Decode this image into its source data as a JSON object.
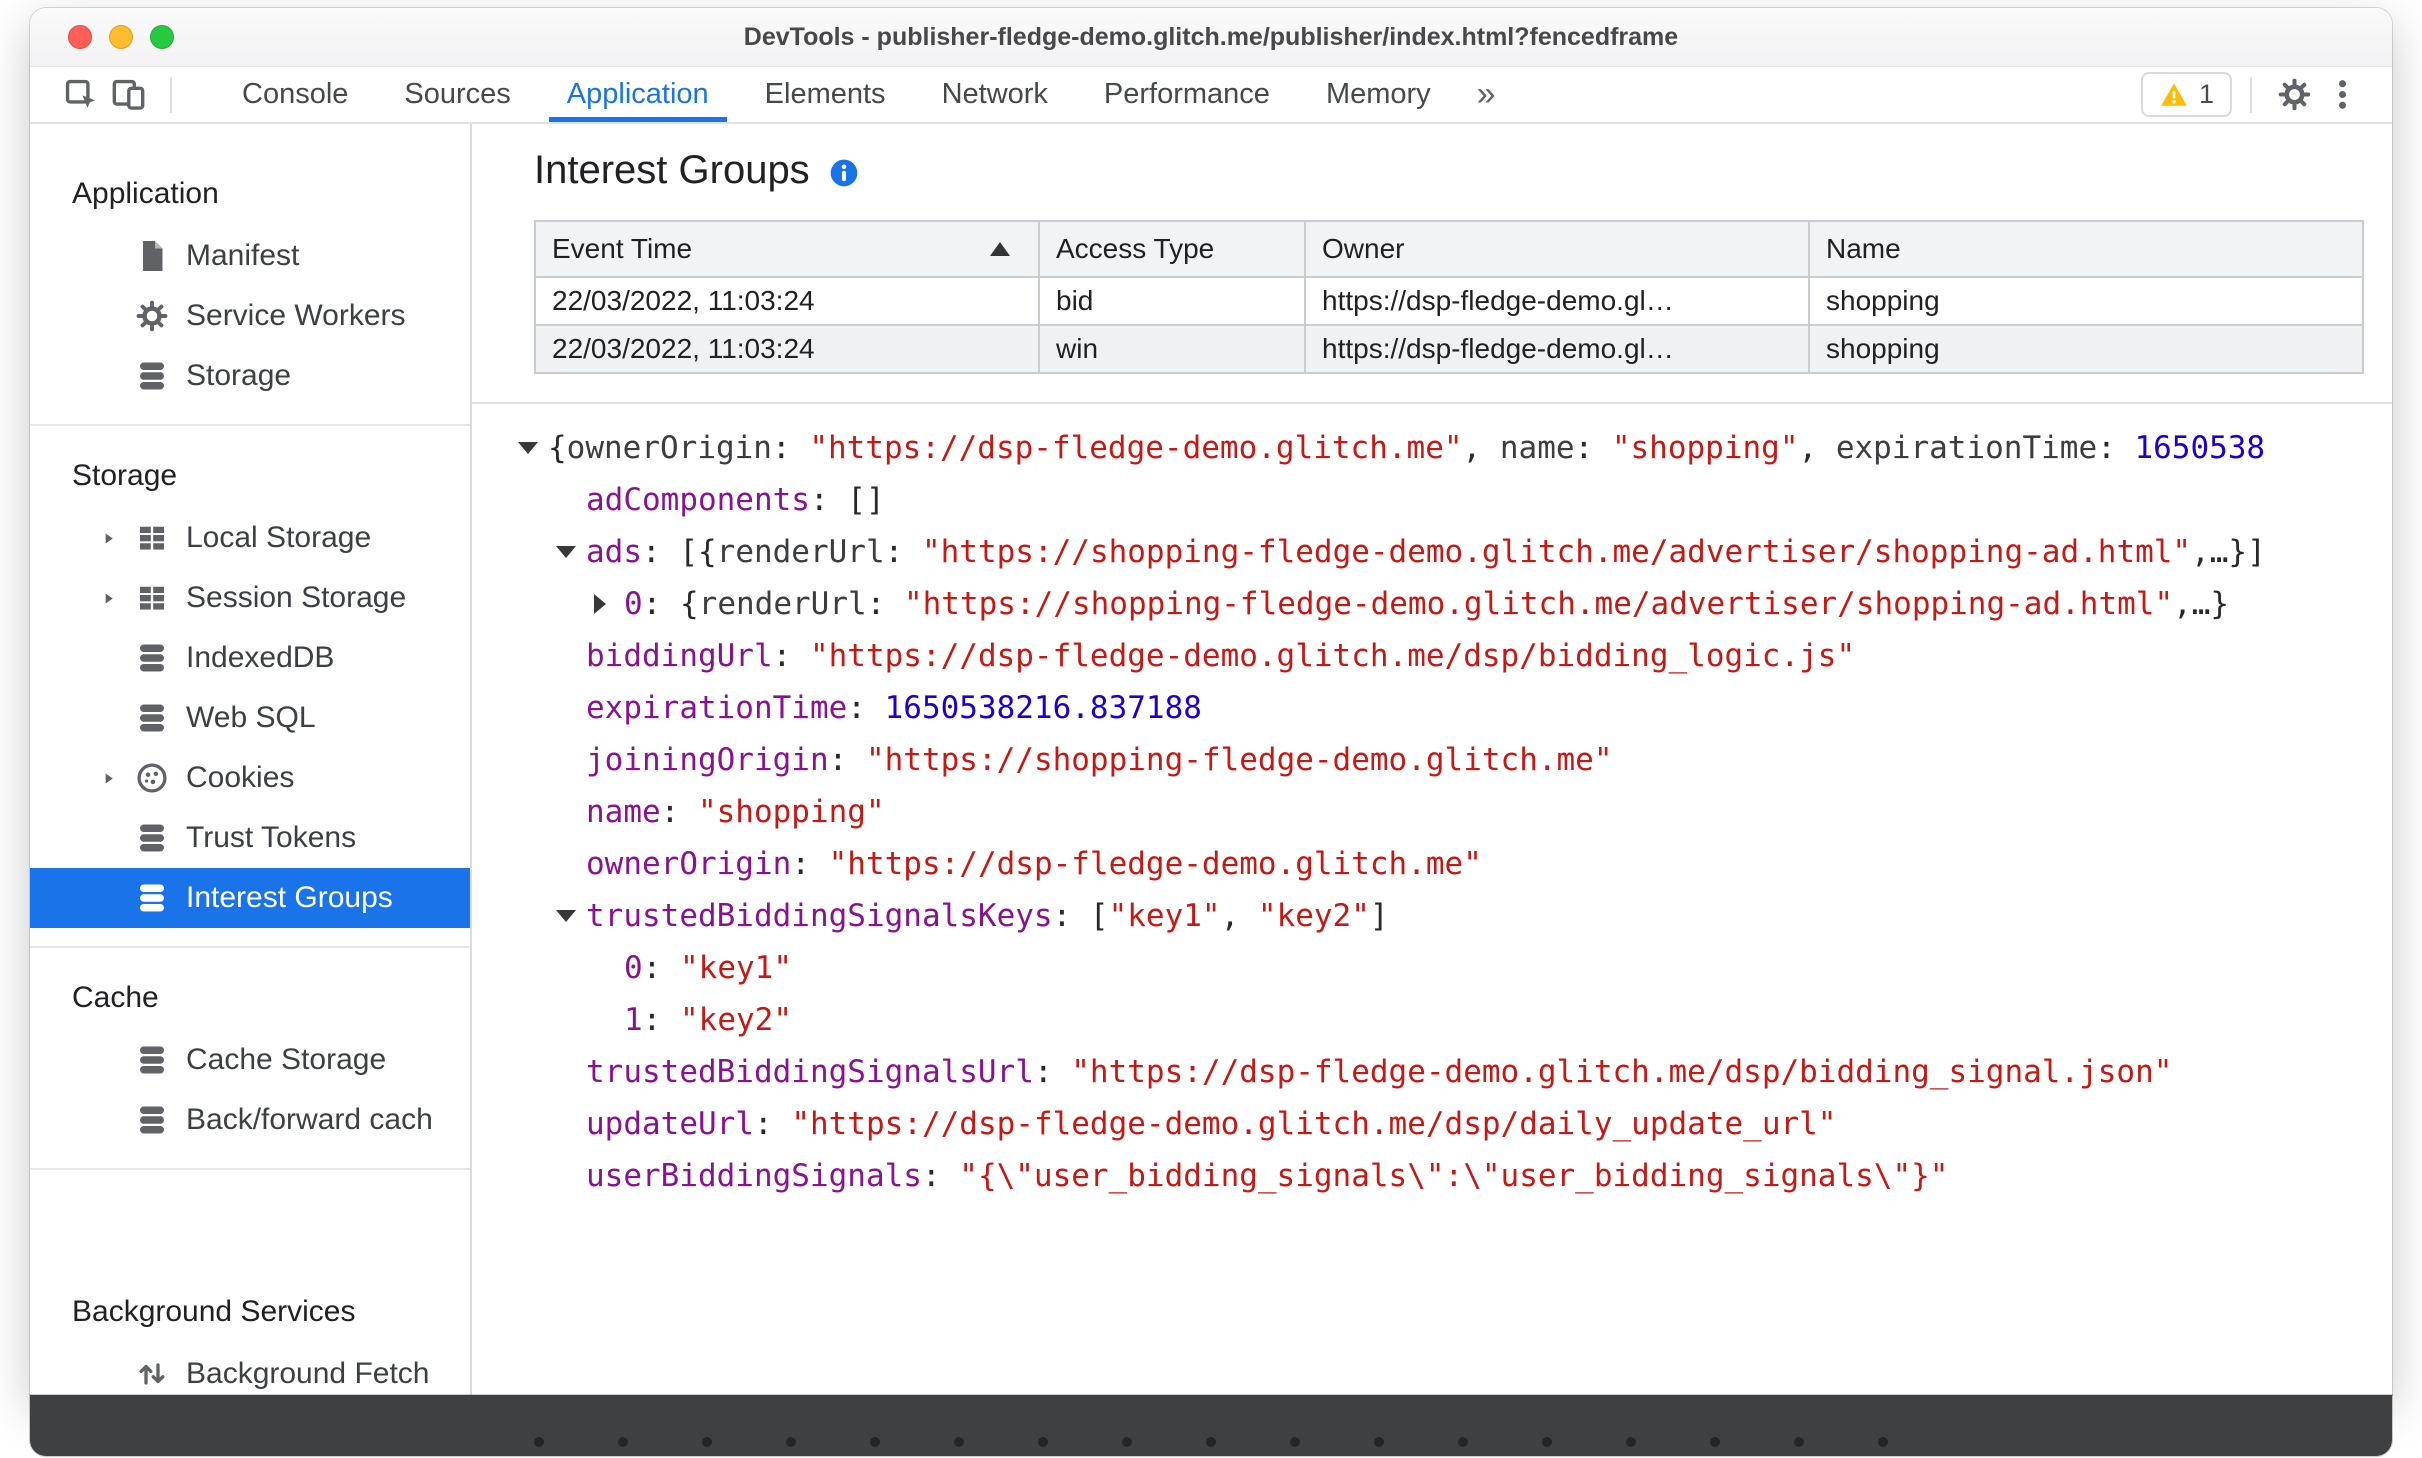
{
  "window": {
    "title": "DevTools - publisher-fledge-demo.glitch.me/publisher/index.html?fencedframe"
  },
  "toolbar": {
    "tabs": [
      {
        "label": "Console",
        "active": false
      },
      {
        "label": "Sources",
        "active": false
      },
      {
        "label": "Application",
        "active": true
      },
      {
        "label": "Elements",
        "active": false
      },
      {
        "label": "Network",
        "active": false
      },
      {
        "label": "Performance",
        "active": false
      },
      {
        "label": "Memory",
        "active": false
      }
    ],
    "more_tabs": "»",
    "warning_count": "1"
  },
  "sidebar": {
    "sections": [
      {
        "title": "Application",
        "items": [
          {
            "label": "Manifest",
            "icon": "document-icon"
          },
          {
            "label": "Service Workers",
            "icon": "gear-icon"
          },
          {
            "label": "Storage",
            "icon": "database-icon"
          }
        ]
      },
      {
        "title": "Storage",
        "items": [
          {
            "label": "Local Storage",
            "icon": "table-icon",
            "expandable": true
          },
          {
            "label": "Session Storage",
            "icon": "table-icon",
            "expandable": true
          },
          {
            "label": "IndexedDB",
            "icon": "database-icon"
          },
          {
            "label": "Web SQL",
            "icon": "database-icon"
          },
          {
            "label": "Cookies",
            "icon": "cookie-icon",
            "expandable": true
          },
          {
            "label": "Trust Tokens",
            "icon": "database-icon"
          },
          {
            "label": "Interest Groups",
            "icon": "database-icon",
            "selected": true
          }
        ]
      },
      {
        "title": "Cache",
        "items": [
          {
            "label": "Cache Storage",
            "icon": "database-icon"
          },
          {
            "label": "Back/forward cach",
            "icon": "database-icon"
          }
        ]
      },
      {
        "title": "Background Services",
        "extra_gap": true,
        "items": [
          {
            "label": "Background Fetch",
            "icon": "fetch-icon"
          }
        ]
      }
    ]
  },
  "main": {
    "title": "Interest Groups",
    "table": {
      "columns": [
        {
          "label": "Event Time",
          "sorted": "asc"
        },
        {
          "label": "Access Type"
        },
        {
          "label": "Owner"
        },
        {
          "label": "Name"
        }
      ],
      "rows": [
        [
          "22/03/2022, 11:03:24",
          "bid",
          "https://dsp-fledge-demo.gl…",
          "shopping"
        ],
        [
          "22/03/2022, 11:03:24",
          "win",
          "https://dsp-fledge-demo.gl…",
          "shopping"
        ]
      ]
    },
    "tree": {
      "lines": [
        {
          "level": 0,
          "arrow": "down",
          "tokens": [
            {
              "t": "plain",
              "v": "{"
            },
            {
              "t": "pkey",
              "v": "ownerOrigin"
            },
            {
              "t": "plain",
              "v": ": "
            },
            {
              "t": "str",
              "v": "\"https://dsp-fledge-demo.glitch.me\""
            },
            {
              "t": "plain",
              "v": ", "
            },
            {
              "t": "pkey",
              "v": "name"
            },
            {
              "t": "plain",
              "v": ": "
            },
            {
              "t": "str",
              "v": "\"shopping\""
            },
            {
              "t": "plain",
              "v": ", "
            },
            {
              "t": "pkey",
              "v": "expirationTime"
            },
            {
              "t": "plain",
              "v": ": "
            },
            {
              "t": "num",
              "v": "1650538"
            }
          ]
        },
        {
          "level": 1,
          "arrow": null,
          "tokens": [
            {
              "t": "key",
              "v": "adComponents"
            },
            {
              "t": "plain",
              "v": ": []"
            }
          ]
        },
        {
          "level": 1,
          "arrow": "down",
          "tokens": [
            {
              "t": "key",
              "v": "ads"
            },
            {
              "t": "plain",
              "v": ": [{"
            },
            {
              "t": "pkey",
              "v": "renderUrl"
            },
            {
              "t": "plain",
              "v": ": "
            },
            {
              "t": "str",
              "v": "\"https://shopping-fledge-demo.glitch.me/advertiser/shopping-ad.html\""
            },
            {
              "t": "plain",
              "v": ",…}]"
            }
          ]
        },
        {
          "level": 2,
          "arrow": "right",
          "tokens": [
            {
              "t": "key",
              "v": "0"
            },
            {
              "t": "plain",
              "v": ": {"
            },
            {
              "t": "pkey",
              "v": "renderUrl"
            },
            {
              "t": "plain",
              "v": ": "
            },
            {
              "t": "str",
              "v": "\"https://shopping-fledge-demo.glitch.me/advertiser/shopping-ad.html\""
            },
            {
              "t": "plain",
              "v": ",…}"
            }
          ]
        },
        {
          "level": 1,
          "arrow": null,
          "tokens": [
            {
              "t": "key",
              "v": "biddingUrl"
            },
            {
              "t": "plain",
              "v": ": "
            },
            {
              "t": "str",
              "v": "\"https://dsp-fledge-demo.glitch.me/dsp/bidding_logic.js\""
            }
          ]
        },
        {
          "level": 1,
          "arrow": null,
          "tokens": [
            {
              "t": "key",
              "v": "expirationTime"
            },
            {
              "t": "plain",
              "v": ": "
            },
            {
              "t": "num",
              "v": "1650538216.837188"
            }
          ]
        },
        {
          "level": 1,
          "arrow": null,
          "tokens": [
            {
              "t": "key",
              "v": "joiningOrigin"
            },
            {
              "t": "plain",
              "v": ": "
            },
            {
              "t": "str",
              "v": "\"https://shopping-fledge-demo.glitch.me\""
            }
          ]
        },
        {
          "level": 1,
          "arrow": null,
          "tokens": [
            {
              "t": "key",
              "v": "name"
            },
            {
              "t": "plain",
              "v": ": "
            },
            {
              "t": "str",
              "v": "\"shopping\""
            }
          ]
        },
        {
          "level": 1,
          "arrow": null,
          "tokens": [
            {
              "t": "key",
              "v": "ownerOrigin"
            },
            {
              "t": "plain",
              "v": ": "
            },
            {
              "t": "str",
              "v": "\"https://dsp-fledge-demo.glitch.me\""
            }
          ]
        },
        {
          "level": 1,
          "arrow": "down",
          "tokens": [
            {
              "t": "key",
              "v": "trustedBiddingSignalsKeys"
            },
            {
              "t": "plain",
              "v": ": ["
            },
            {
              "t": "str",
              "v": "\"key1\""
            },
            {
              "t": "plain",
              "v": ", "
            },
            {
              "t": "str",
              "v": "\"key2\""
            },
            {
              "t": "plain",
              "v": "]"
            }
          ]
        },
        {
          "level": 2,
          "arrow": null,
          "tokens": [
            {
              "t": "key",
              "v": "0"
            },
            {
              "t": "plain",
              "v": ": "
            },
            {
              "t": "str",
              "v": "\"key1\""
            }
          ]
        },
        {
          "level": 2,
          "arrow": null,
          "tokens": [
            {
              "t": "key",
              "v": "1"
            },
            {
              "t": "plain",
              "v": ": "
            },
            {
              "t": "str",
              "v": "\"key2\""
            }
          ]
        },
        {
          "level": 1,
          "arrow": null,
          "tokens": [
            {
              "t": "key",
              "v": "trustedBiddingSignalsUrl"
            },
            {
              "t": "plain",
              "v": ": "
            },
            {
              "t": "str",
              "v": "\"https://dsp-fledge-demo.glitch.me/dsp/bidding_signal.json\""
            }
          ]
        },
        {
          "level": 1,
          "arrow": null,
          "tokens": [
            {
              "t": "key",
              "v": "updateUrl"
            },
            {
              "t": "plain",
              "v": ": "
            },
            {
              "t": "str",
              "v": "\"https://dsp-fledge-demo.glitch.me/dsp/daily_update_url\""
            }
          ]
        },
        {
          "level": 1,
          "arrow": null,
          "tokens": [
            {
              "t": "key",
              "v": "userBiddingSignals"
            },
            {
              "t": "plain",
              "v": ": "
            },
            {
              "t": "str",
              "v": "\"{\\\"user_bidding_signals\\\":\\\"user_bidding_signals\\\"}\""
            }
          ]
        }
      ]
    }
  },
  "bottom_bar": {
    "dot_count": 17
  },
  "colors": {
    "accent": "#1a73e8",
    "tree_key": "#881391",
    "tree_string": "#c41a16",
    "tree_number": "#1c00cf",
    "warning": "#FBBC04"
  }
}
